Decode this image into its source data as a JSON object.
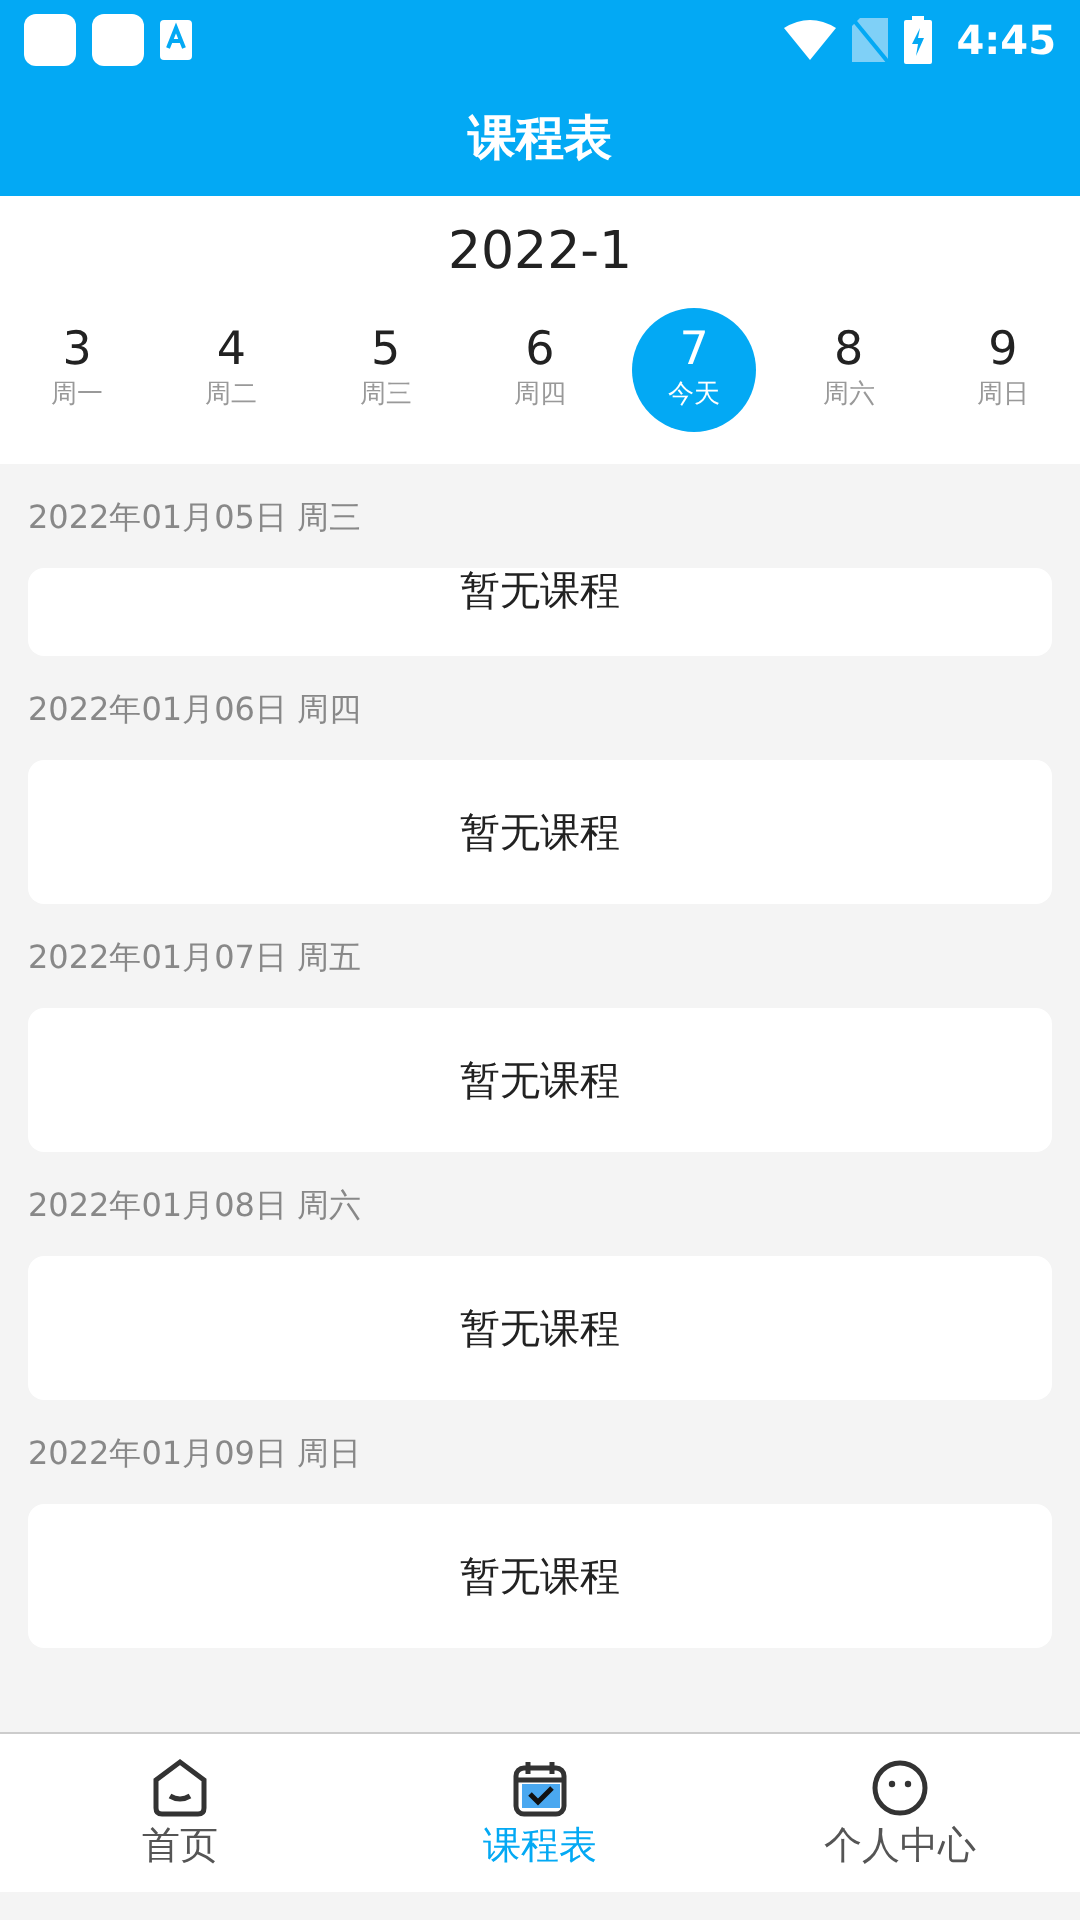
{
  "status_bar": {
    "time": "4:45"
  },
  "header": {
    "title": "课程表"
  },
  "month": "2022-1",
  "week": [
    {
      "day": "3",
      "label": "周一",
      "selected": false
    },
    {
      "day": "4",
      "label": "周二",
      "selected": false
    },
    {
      "day": "5",
      "label": "周三",
      "selected": false
    },
    {
      "day": "6",
      "label": "周四",
      "selected": false
    },
    {
      "day": "7",
      "label": "今天",
      "selected": true
    },
    {
      "day": "8",
      "label": "周六",
      "selected": false
    },
    {
      "day": "9",
      "label": "周日",
      "selected": false
    }
  ],
  "schedule": [
    {
      "date": "2022年01月05日 周三",
      "text": "暂无课程"
    },
    {
      "date": "2022年01月06日 周四",
      "text": "暂无课程"
    },
    {
      "date": "2022年01月07日 周五",
      "text": "暂无课程"
    },
    {
      "date": "2022年01月08日 周六",
      "text": "暂无课程"
    },
    {
      "date": "2022年01月09日 周日",
      "text": "暂无课程"
    }
  ],
  "tab_bar": [
    {
      "kind": "home",
      "label": "首页",
      "selected": false
    },
    {
      "kind": "calendar",
      "label": "课程表",
      "selected": true
    },
    {
      "kind": "profile",
      "label": "个人中心",
      "selected": false
    }
  ]
}
